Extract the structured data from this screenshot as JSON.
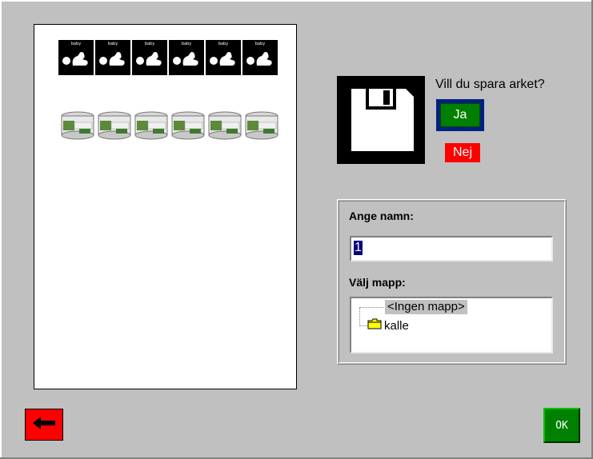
{
  "sheet": {
    "baby_row": {
      "label": "baby",
      "count": 6
    },
    "can_row": {
      "count": 6
    }
  },
  "save_dialog": {
    "question": "Vill du spara arket?",
    "yes_label": "Ja",
    "no_label": "Nej"
  },
  "name_panel": {
    "name_label": "Ange namn:",
    "name_value": "1",
    "folder_label": "Välj mapp:",
    "folders": [
      {
        "label": "<Ingen mapp>",
        "selected": true,
        "icon": "none"
      },
      {
        "label": "kalle",
        "selected": false,
        "icon": "folder-icon"
      }
    ]
  },
  "footer": {
    "back_icon": "arrow-left-icon",
    "ok_label": "OK"
  },
  "colors": {
    "background": "#c0c0c0",
    "yes_green": "#008000",
    "no_red": "#ff0000",
    "focus_frame": "#002080",
    "selection": "#000080"
  }
}
